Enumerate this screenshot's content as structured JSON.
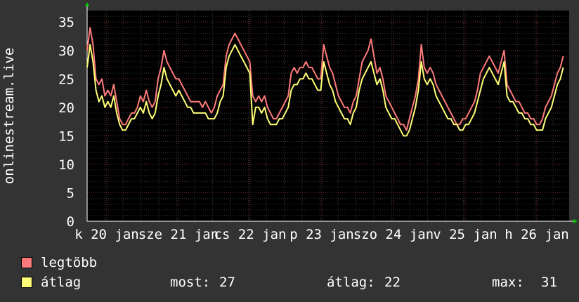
{
  "chart_data": {
    "type": "line",
    "ylabel": "onlinestream.live",
    "xlabel": "",
    "ylim": [
      0,
      37
    ],
    "grid": true,
    "y_ticks": [
      0,
      5,
      10,
      15,
      20,
      25,
      30,
      35
    ],
    "x_tick_labels": [
      "k 20 jan",
      "sze 21 jan",
      "cs 22 jan",
      "p 23 jan",
      "szo 24 jan",
      "v 25 jan",
      "h 26 jan"
    ],
    "x_days": [
      "2015-01-20",
      "2015-01-21",
      "2015-01-22",
      "2015-01-23",
      "2015-01-24",
      "2015-01-25",
      "2015-01-26"
    ],
    "x_range_hours": [
      0,
      163
    ],
    "sample_interval_hours": 1,
    "series": [
      {
        "name": "legtöbb",
        "color": "#ff7b7b",
        "values": [
          30,
          34,
          31,
          25,
          24,
          25,
          22,
          23,
          22,
          24,
          21,
          18,
          17,
          17,
          18,
          19,
          19,
          20,
          22,
          21,
          23,
          21,
          20,
          21,
          25,
          27,
          30,
          28,
          27,
          26,
          25,
          25,
          24,
          23,
          22,
          21,
          21,
          21,
          21,
          20,
          21,
          20,
          19,
          20,
          22,
          23,
          24,
          29,
          31,
          32,
          33,
          32,
          31,
          30,
          29,
          28,
          22,
          21,
          22,
          21,
          22,
          20,
          19,
          18,
          18,
          19,
          20,
          21,
          22,
          26,
          27,
          26,
          27,
          27,
          28,
          27,
          27,
          26,
          25,
          25,
          31,
          29,
          27,
          26,
          24,
          22,
          21,
          20,
          20,
          19,
          21,
          22,
          25,
          28,
          29,
          30,
          32,
          29,
          26,
          27,
          25,
          22,
          21,
          20,
          19,
          18,
          17,
          17,
          16,
          18,
          20,
          22,
          25,
          31,
          27,
          26,
          27,
          26,
          24,
          23,
          22,
          21,
          20,
          19,
          18,
          17,
          17,
          18,
          18,
          19,
          20,
          21,
          23,
          26,
          27,
          28,
          29,
          28,
          27,
          26,
          28,
          30,
          24,
          23,
          22,
          21,
          21,
          20,
          19,
          19,
          18,
          18,
          17,
          17,
          18,
          20,
          21,
          22,
          24,
          26,
          27,
          29
        ]
      },
      {
        "name": "átlag",
        "color": "#ffff77",
        "values": [
          27,
          31,
          28,
          23,
          21,
          22,
          20,
          21,
          20,
          22,
          19,
          17,
          16,
          16,
          17,
          18,
          18,
          19,
          20,
          19,
          21,
          19,
          18,
          19,
          22,
          24,
          27,
          25,
          24,
          23,
          22,
          23,
          22,
          21,
          20,
          20,
          19,
          19,
          19,
          19,
          19,
          18,
          18,
          18,
          19,
          21,
          22,
          27,
          29,
          30,
          31,
          30,
          29,
          28,
          27,
          26,
          17,
          20,
          20,
          19,
          20,
          18,
          17,
          17,
          17,
          18,
          18,
          19,
          20,
          23,
          24,
          24,
          25,
          25,
          26,
          25,
          25,
          24,
          23,
          23,
          28,
          26,
          24,
          23,
          21,
          20,
          19,
          18,
          18,
          17,
          19,
          20,
          23,
          25,
          26,
          27,
          28,
          26,
          24,
          25,
          23,
          20,
          19,
          18,
          18,
          17,
          16,
          15,
          15,
          16,
          18,
          20,
          23,
          28,
          25,
          24,
          25,
          24,
          22,
          21,
          20,
          19,
          18,
          18,
          17,
          17,
          16,
          16,
          17,
          17,
          18,
          19,
          21,
          23,
          25,
          26,
          27,
          26,
          25,
          24,
          26,
          28,
          22,
          21,
          21,
          20,
          19,
          19,
          18,
          18,
          17,
          17,
          16,
          16,
          16,
          18,
          19,
          20,
          22,
          24,
          25,
          27
        ]
      }
    ],
    "legend": [
      {
        "label": "legtöbb",
        "color": "#ff7b7b"
      },
      {
        "label": "átlag",
        "color": "#ffff77"
      }
    ],
    "stats": {
      "now_label": "most:",
      "now_value": "27",
      "avg_label": "átlag:",
      "avg_value": "22",
      "max_label": "max:",
      "max_value": "31"
    }
  }
}
